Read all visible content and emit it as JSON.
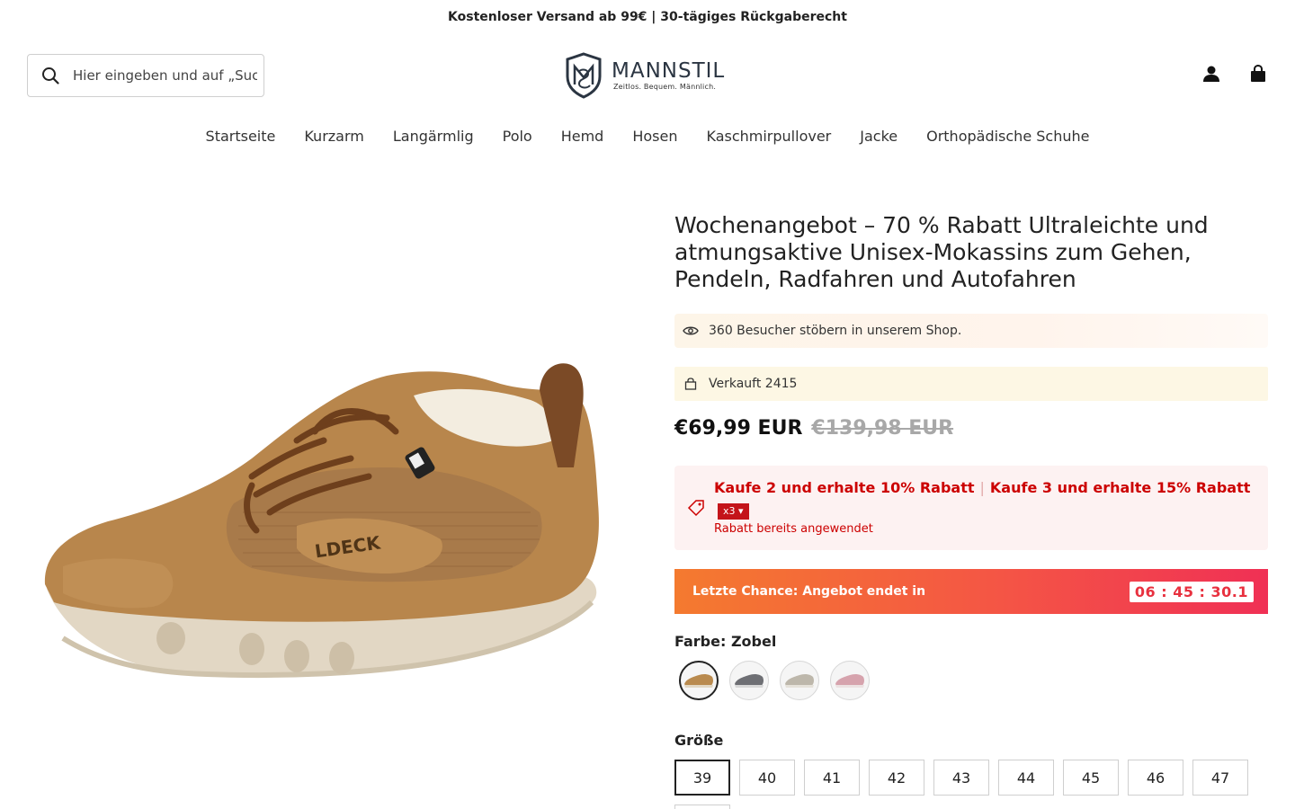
{
  "announcement": "Kostenloser Versand ab 99€ | 30-tägiges Rückgaberecht",
  "search": {
    "placeholder": "Hier eingeben und auf „Suchen“ klicken"
  },
  "logo": {
    "brand": "MANNSTIL",
    "tagline": "Zeitlos. Bequem. Männlich."
  },
  "header_icons": [
    "account-icon",
    "cart-icon"
  ],
  "nav": [
    "Startseite",
    "Kurzarm",
    "Langärmlig",
    "Polo",
    "Hemd",
    "Hosen",
    "Kaschmirpullover",
    "Jacke",
    "Orthopädische Schuhe"
  ],
  "product": {
    "title": "Wochenangebot – 70 % Rabatt Ultraleichte und atmungsaktive Unisex-Mokassins zum Gehen, Pendeln, Radfahren und Autofahren",
    "visitors": "360 Besucher stöbern in unserem Shop.",
    "sold": "Verkauft 2415",
    "price": "€69,99 EUR",
    "compare_price": "€139,98 EUR",
    "promo": {
      "offer1": "Kaufe 2 und erhalte 10% Rabatt",
      "offer2": "Kaufe 3 und erhalte 15% Rabatt",
      "qty": "x3",
      "applied": "Rabatt bereits angewendet"
    },
    "countdown": {
      "label": "Letzte Chance: Angebot endet in",
      "timer": "06 : 45 : 30.1"
    },
    "color_label": "Farbe: Zobel",
    "colors": [
      "#b98a4e",
      "#6e6f74",
      "#bdb7ab",
      "#d6a3ad"
    ],
    "size_label": "Größe",
    "sizes": [
      "39",
      "40",
      "41",
      "42",
      "43",
      "44",
      "45",
      "46",
      "47"
    ],
    "selected_size": "39",
    "shoe_print": "LDECK"
  },
  "colors": {
    "accent_red": "#c00000",
    "countdown_start": "#f47a2f",
    "countdown_end": "#f03055"
  }
}
